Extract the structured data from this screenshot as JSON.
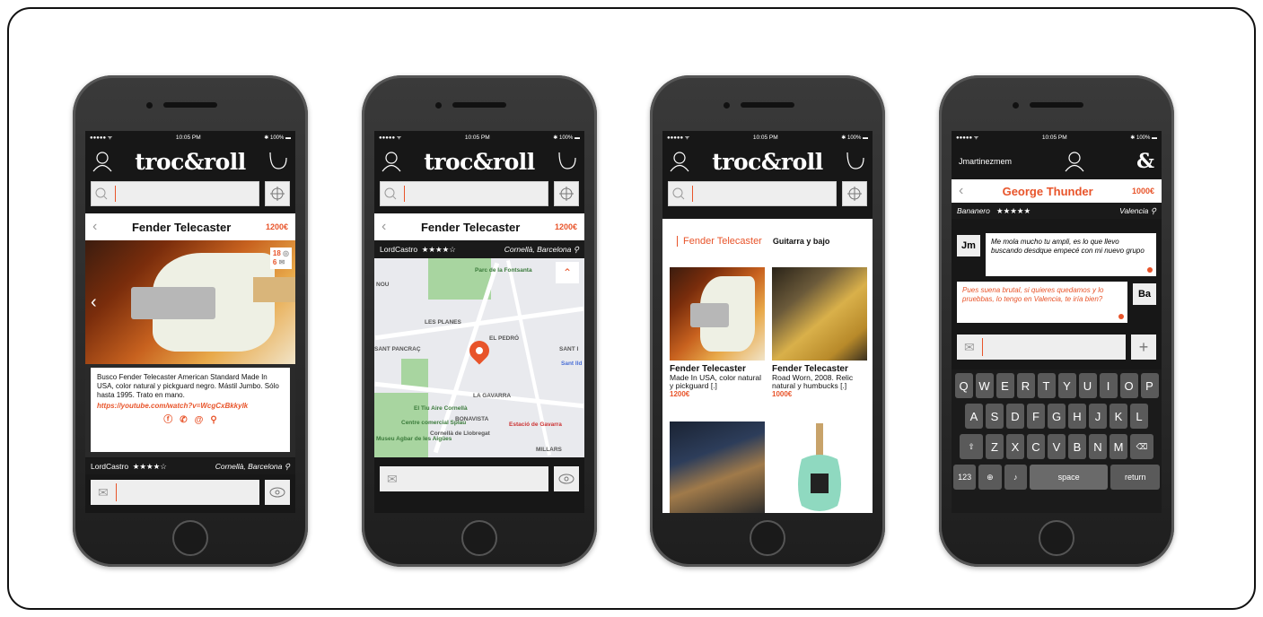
{
  "status": {
    "signal": "●●●●● ᯤ",
    "time": "10:05 PM",
    "battery": "✱ 100% ▬"
  },
  "app": {
    "logo": "troc&roll"
  },
  "phone1": {
    "title": "Fender Telecaster",
    "price": "1200€",
    "views": "18",
    "messages": "6",
    "description": "Busco Fender Telecaster American Standard Made In USA, color natural y pickguard negro. Mástil Jumbo. Sólo hasta 1995. Trato en mano.",
    "link": "https://youtube.com/watch?v=WcgCxBkkyIk",
    "seller": "LordCastro",
    "stars": "★★★★☆",
    "location": "Cornellà, Barcelona"
  },
  "phone2": {
    "title": "Fender Telecaster",
    "price": "1200€",
    "seller": "LordCastro",
    "stars": "★★★★☆",
    "location": "Cornellà, Barcelona",
    "map_labels": [
      "NOU",
      "Parc de la Fontsanta",
      "LES PLANES",
      "SANT PANCRAÇ",
      "EL PEDRÓ",
      "SANT I",
      "Sant Ild",
      "LA GAVARRA",
      "BONAVISTA",
      "Estació de Gavarra",
      "El Tiu Aire Cornellà",
      "Centre comercial Splau",
      "Cornellà de Llobregat",
      "Museu Agbar de les Aigües",
      "MILLARS"
    ]
  },
  "phone3": {
    "tab_active": "Fender Telecaster",
    "tab_other": "Guitarra y bajo",
    "cards": [
      {
        "title": "Fender Telecaster",
        "desc": "Made In USA, color natural y pickguard [.]",
        "price": "1200€"
      },
      {
        "title": "Fender Telecaster",
        "desc": "Road Worn, 2008. Relic natural y humbucks [.]",
        "price": "1000€"
      }
    ]
  },
  "phone4": {
    "user": "Jmartinezmem",
    "logo": "&",
    "title": "George Thunder",
    "price": "1000€",
    "seller": "Bananero",
    "stars": "★★★★★",
    "location": "Valencia",
    "msg1_avatar": "Jm",
    "msg1": "Me mola mucho tu ampli, es lo que llevo buscando desdque empecé con mi nuevo grupo",
    "msg2_avatar": "Ba",
    "msg2": "Pues suena brutal, si quieres quedamos y lo pruebbas, lo tengo en Valencia, te iría bien?",
    "keyboard": {
      "row1": [
        "Q",
        "W",
        "E",
        "R",
        "T",
        "Y",
        "U",
        "I",
        "O",
        "P"
      ],
      "row2": [
        "A",
        "S",
        "D",
        "F",
        "G",
        "H",
        "J",
        "K",
        "L"
      ],
      "row3": [
        "Z",
        "X",
        "C",
        "V",
        "B",
        "N",
        "M"
      ],
      "num": "123",
      "space": "space",
      "return": "return"
    }
  }
}
